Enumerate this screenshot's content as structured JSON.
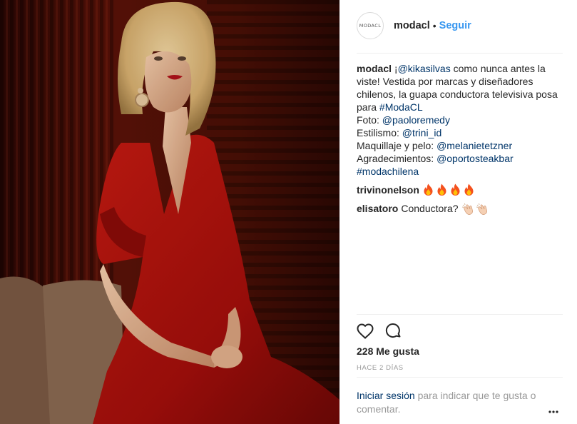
{
  "photo": {
    "description_icon": "portrait-photo"
  },
  "header": {
    "avatar_text": "MODACL",
    "username": "modacl",
    "separator": "•",
    "follow_label": "Seguir"
  },
  "caption": {
    "username": "modacl",
    "line1_pre": "¡",
    "mention1": "@kikasilvas",
    "line1_post": " como nunca antes la viste! Vestida por marcas y diseñadores chilenos, la guapa conductora televisiva posa para ",
    "hashtag1": "#ModaCL",
    "foto_label": "Foto: ",
    "foto_mention": "@paoloremedy",
    "estilismo_label": "Estilismo: ",
    "estilismo_mention": "@trini_id",
    "maquillaje_label": "Maquillaje y pelo: ",
    "maquillaje_mention": "@melanietetzner",
    "agradecimientos_label": "Agradecimientos: ",
    "agradecimientos_mention": "@oportosteakbar",
    "hashtag2": "#modachilena"
  },
  "comments": [
    {
      "username": "trivinonelson",
      "text": "",
      "emoji": "fire-icon",
      "emoji_count": 4
    },
    {
      "username": "elisatoro",
      "text": "Conductora?",
      "emoji": "clapping-hands-icon",
      "emoji_count": 2
    }
  ],
  "actions": {
    "like_icon": "heart-icon",
    "comment_icon": "comment-icon"
  },
  "likes": "228 Me gusta",
  "timestamp": "HACE 2 DÍAS",
  "login": {
    "link": "Iniciar sesión",
    "rest": " para indicar que te gusta o comentar."
  },
  "colors": {
    "link": "#003569",
    "follow": "#3897f0",
    "muted": "#999999",
    "text": "#262626"
  }
}
